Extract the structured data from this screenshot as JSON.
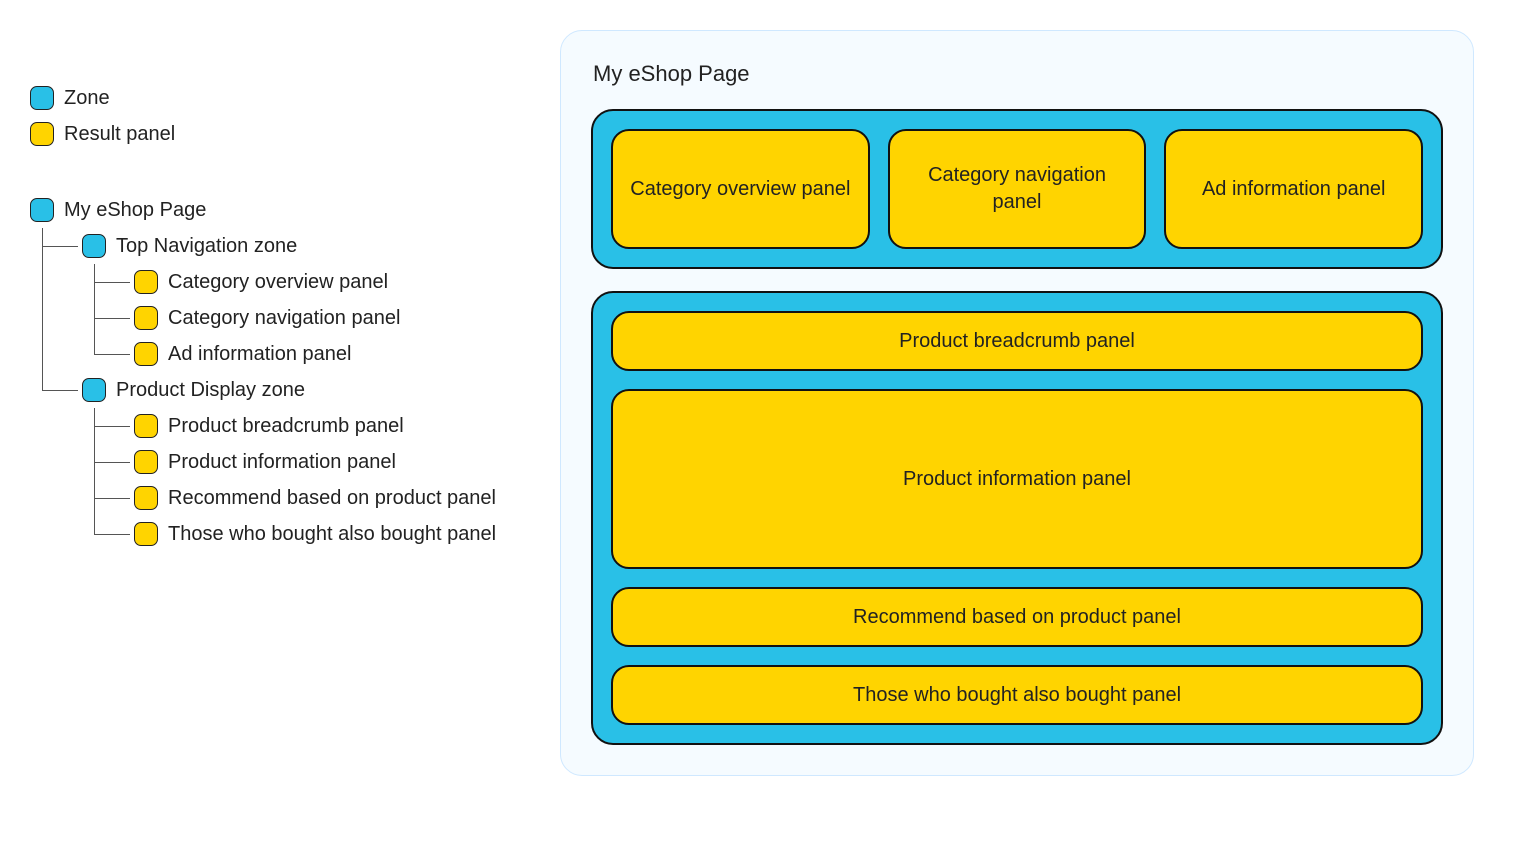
{
  "colors": {
    "zone": "#29c0e7",
    "panel": "#ffd400"
  },
  "legend": {
    "zone": "Zone",
    "panel": "Result panel"
  },
  "tree": {
    "root": {
      "label": "My eShop Page",
      "zones": [
        {
          "label": "Top Navigation zone",
          "panels": [
            "Category overview panel",
            "Category navigation panel",
            "Ad information panel"
          ]
        },
        {
          "label": "Product Display zone",
          "panels": [
            "Product breadcrumb panel",
            "Product information panel",
            "Recommend based on product panel",
            "Those who bought also bought panel"
          ]
        }
      ]
    }
  },
  "mockup": {
    "title": "My eShop Page",
    "top": [
      "Category overview panel",
      "Category navigation panel",
      "Ad information panel"
    ],
    "body": [
      {
        "label": "Product breadcrumb panel",
        "size": "row"
      },
      {
        "label": "Product information panel",
        "size": "big"
      },
      {
        "label": "Recommend based on product panel",
        "size": "row"
      },
      {
        "label": "Those who bought also bought panel",
        "size": "row"
      }
    ]
  }
}
